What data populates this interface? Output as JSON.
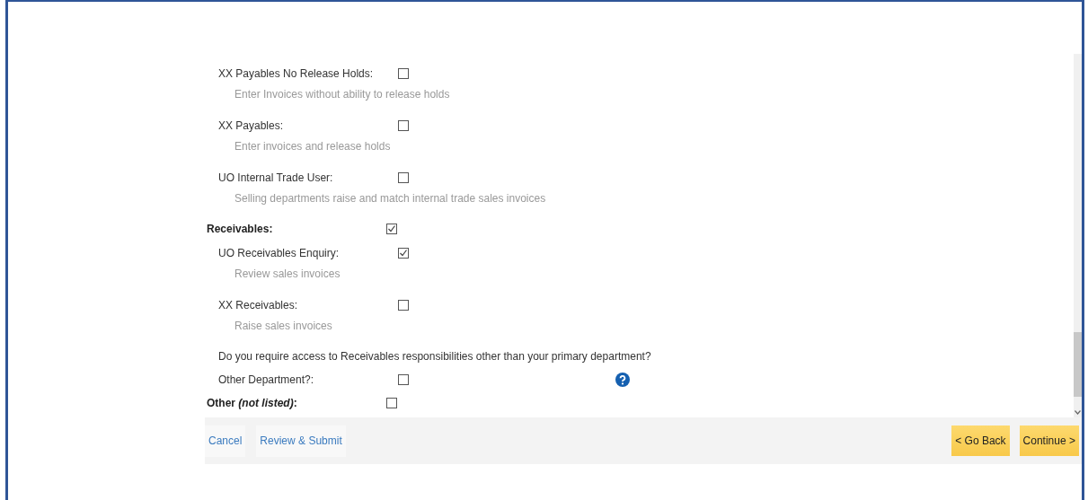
{
  "items": [
    {
      "kind": "option",
      "label": "XX Payables No Release Holds:",
      "checked": false,
      "description": "Enter Invoices without ability to release holds"
    },
    {
      "kind": "option",
      "label": "XX Payables:",
      "checked": false,
      "description": "Enter invoices and release holds"
    },
    {
      "kind": "option",
      "label": "UO Internal Trade User:",
      "checked": false,
      "description": "Selling departments raise and match internal trade sales invoices"
    },
    {
      "kind": "group",
      "label": "Receivables:",
      "checked": true
    },
    {
      "kind": "option",
      "label": "UO Receivables Enquiry:",
      "checked": true,
      "description": "Review sales invoices"
    },
    {
      "kind": "option",
      "label": "XX Receivables:",
      "checked": false,
      "description": "Raise sales invoices"
    },
    {
      "kind": "question",
      "text": "Do you require access to Receivables responsibilities other than your primary department?"
    },
    {
      "kind": "help-option",
      "label": "Other Department?:",
      "checked": false
    },
    {
      "kind": "group",
      "label": "Other *(not listed)*:",
      "checked": false
    }
  ],
  "footer": {
    "links": [
      "Cancel",
      "Review & Submit"
    ],
    "buttons": [
      "< Go Back",
      "Continue >"
    ]
  }
}
